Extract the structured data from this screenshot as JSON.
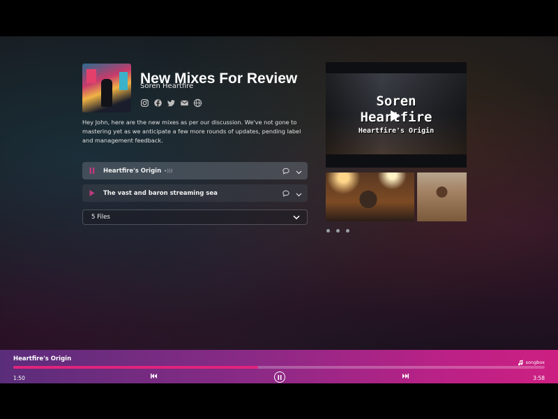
{
  "review": {
    "title": "New Mixes For Review",
    "artist": "Soren Heartfire",
    "description": "Hey John, here are the new mixes as per our discussion. We've not gone to mastering yet as we anticipate a few more rounds of updates, pending label and management feedback."
  },
  "socials": [
    "instagram-icon",
    "facebook-icon",
    "twitter-icon",
    "email-icon",
    "web-icon"
  ],
  "tracks": [
    {
      "name": "Heartfire's Origin",
      "state": "playing"
    },
    {
      "name": "The vast and baron streaming sea",
      "state": "stopped"
    }
  ],
  "files": {
    "label": "5 Files"
  },
  "video": {
    "line1": "Soren",
    "line2": "Heartfire",
    "line3": "Heartfire's Origin"
  },
  "gallery": {
    "dots": 3
  },
  "player": {
    "title": "Heartfire's Origin",
    "elapsed": "1:50",
    "total": "3:58",
    "progress_fraction": 0.46,
    "brand": "songbox"
  },
  "colors": {
    "accent": "#e0247c",
    "playing_icon": "#c0397f"
  }
}
